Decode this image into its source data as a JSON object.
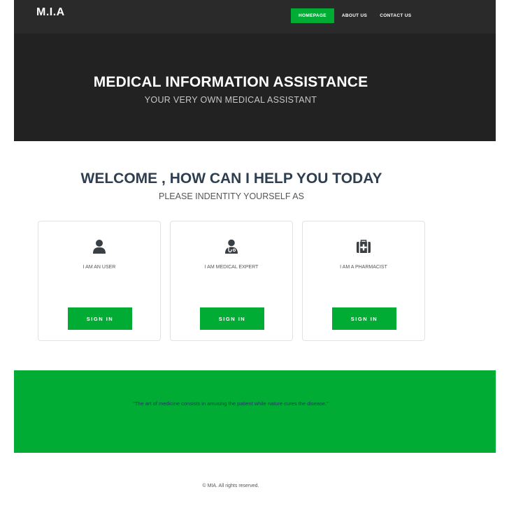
{
  "brand": "M.I.A",
  "nav": {
    "items": [
      "HOMEPAGE",
      "ABOUT US",
      "CONTACT US"
    ]
  },
  "hero": {
    "title": "MEDICAL INFORMATION ASSISTANCE",
    "subtitle": "YOUR VERY OWN MEDICAL ASSISTANT"
  },
  "welcome": {
    "title": "WELCOME , HOW CAN I HELP YOU TODAY",
    "subtitle": "PLEASE INDENTITY YOURSELF AS"
  },
  "cards": [
    {
      "icon": "user-icon",
      "label": "I AM AN USER",
      "button": "SIGN IN"
    },
    {
      "icon": "doctor-icon",
      "label": "I AM MEDICAL EXPERT",
      "button": "SIGN IN"
    },
    {
      "icon": "medkit-icon",
      "label": "I AM A PHARMACIST",
      "button": "SIGN IN"
    }
  ],
  "quote": "\"The art of medicine consists in amusing the patient while nature cures the disease.\"",
  "footer": "© MIA. All rights reserved.",
  "colors": {
    "accent": "#00ac33",
    "dark": "#222222",
    "heading": "#2c3e50"
  }
}
